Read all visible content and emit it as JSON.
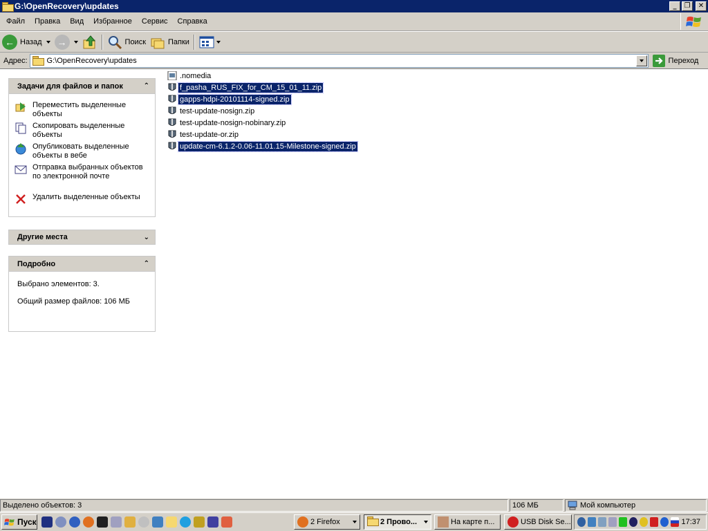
{
  "window": {
    "title": "G:\\OpenRecovery\\updates",
    "controls": {
      "minimize": "_",
      "maximize": "❐",
      "close": "✕"
    }
  },
  "menu": [
    "Файл",
    "Правка",
    "Вид",
    "Избранное",
    "Сервис",
    "Справка"
  ],
  "toolbar": {
    "back_label": "Назад",
    "search_label": "Поиск",
    "folders_label": "Папки"
  },
  "address": {
    "label": "Адрес:",
    "path": "G:\\OpenRecovery\\updates",
    "go_label": "Переход"
  },
  "taskpane": {
    "file_tasks": {
      "title": "Задачи для файлов и папок",
      "items": [
        {
          "label": "Переместить выделенные объекты",
          "icon": "move-icon"
        },
        {
          "label": "Скопировать выделенные объекты",
          "icon": "copy-icon"
        },
        {
          "label": "Опубликовать выделенные объекты в вебе",
          "icon": "publish-web-icon"
        },
        {
          "label": "Отправка выбранных объектов по электронной почте",
          "icon": "email-icon"
        },
        {
          "label": "Удалить выделенные объекты",
          "icon": "delete-icon"
        }
      ]
    },
    "other_places": {
      "title": "Другие места"
    },
    "details": {
      "title": "Подробно",
      "selected": "Выбрано элементов: 3.",
      "total_size": "Общий размер файлов: 106 МБ"
    }
  },
  "files": [
    {
      "name": ".nomedia",
      "selected": false,
      "icon": "file-icon"
    },
    {
      "name": "f_pasha_RUS_FIX_for_CM_15_01_11.zip",
      "selected": true,
      "icon": "zip-icon"
    },
    {
      "name": "gapps-hdpi-20101114-signed.zip",
      "selected": true,
      "icon": "zip-icon"
    },
    {
      "name": "test-update-nosign.zip",
      "selected": false,
      "icon": "zip-icon"
    },
    {
      "name": "test-update-nosign-nobinary.zip",
      "selected": false,
      "icon": "zip-icon"
    },
    {
      "name": "test-update-or.zip",
      "selected": false,
      "icon": "zip-icon"
    },
    {
      "name": "update-cm-6.1.2-0.06-11.01.15-Milestone-signed.zip",
      "selected": true,
      "icon": "zip-icon"
    }
  ],
  "status": {
    "selected_count": "Выделено объектов: 3",
    "size": "106 МБ",
    "location": "Мой компьютер"
  },
  "taskbar": {
    "start_label": "Пуск",
    "buttons": [
      {
        "label": "2 Firefox",
        "active": false
      },
      {
        "label": "2 Прово...",
        "active": true
      },
      {
        "label": "На карте п...",
        "active": false
      },
      {
        "label": "USB Disk Se...",
        "active": false
      }
    ],
    "clock": "17:37"
  },
  "colors": {
    "titlebar": "#0a246a",
    "selection": "#0a246a",
    "chrome": "#d4d0c8"
  }
}
